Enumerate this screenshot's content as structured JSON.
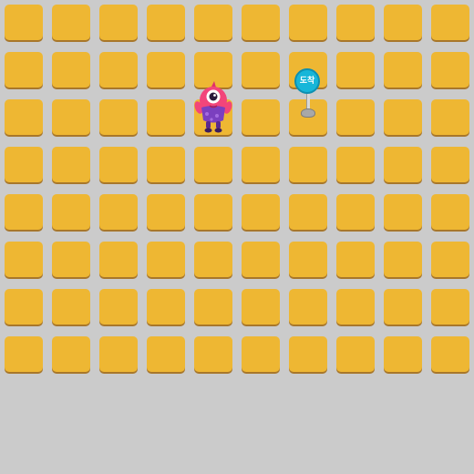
{
  "board": {
    "columns": 10,
    "rows": 8,
    "tile_color": "#eeb733",
    "tile_shadow_color": "#a8772b",
    "background_color": "#cbcbcb"
  },
  "character": {
    "icon": "pink-one-eyed-monster-icon",
    "grid_position": {
      "column": 5,
      "row": 3
    },
    "colors": {
      "body": "#f2457a",
      "clothes": "#7b3fbf"
    }
  },
  "goal": {
    "icon": "arrival-sign-icon",
    "label": "도착",
    "grid_position": {
      "column": 7,
      "row": 3
    },
    "color": "#16b6d9"
  }
}
